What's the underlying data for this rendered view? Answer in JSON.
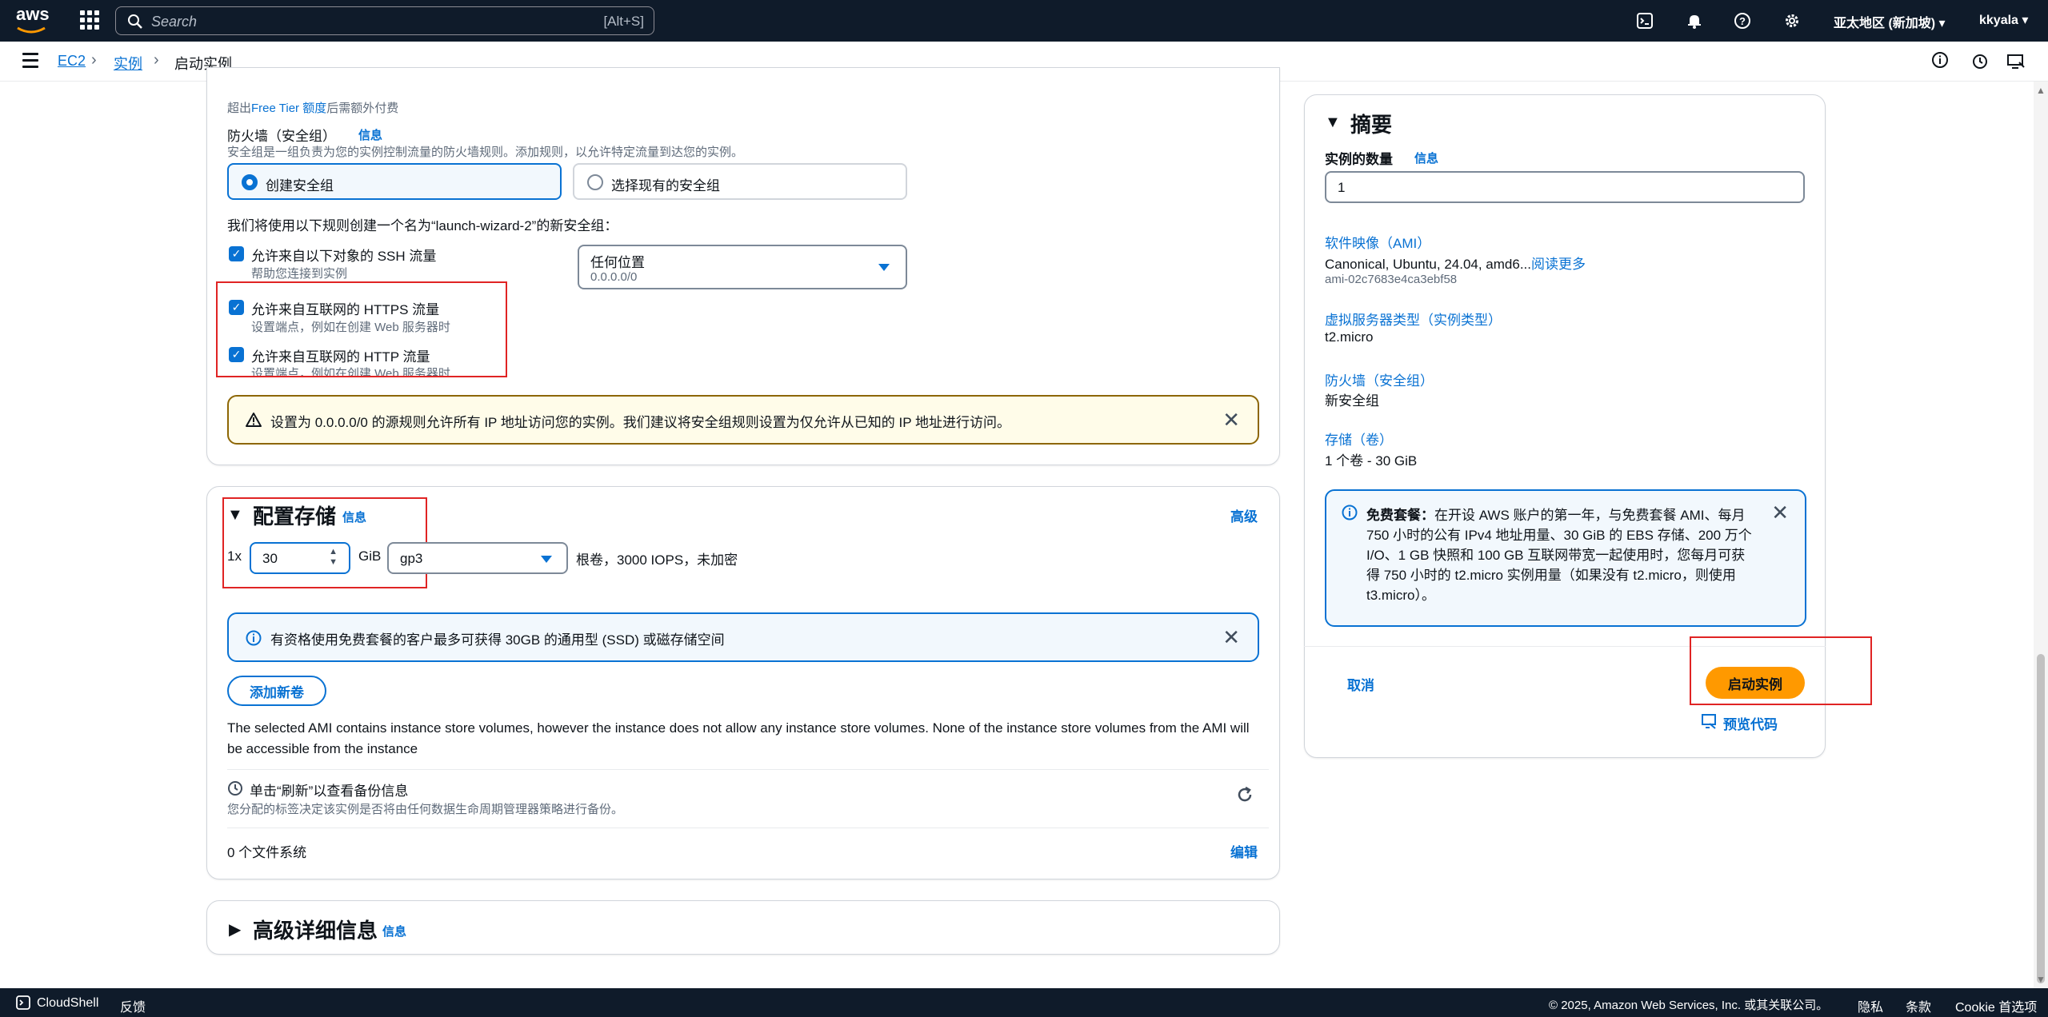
{
  "topnav": {
    "logo": "aws",
    "search_placeholder": "Search",
    "search_shortcut": "[Alt+S]",
    "region": "亚太地区 (新加坡) ▾",
    "user": "kkyala ▾"
  },
  "breadcrumb": {
    "items": [
      "EC2",
      "实例",
      "启动实例"
    ]
  },
  "security": {
    "over_free_tier_prefix": "超出",
    "over_free_tier_link": "Free Tier 额度",
    "over_free_tier_suffix": "后需额外付费",
    "firewall_label": "防火墙（安全组）",
    "info": "信息",
    "firewall_desc": "安全组是一组负责为您的实例控制流量的防火墙规则。添加规则，以允许特定流量到达您的实例。",
    "option_create": "创建安全组",
    "option_existing": "选择现有的安全组",
    "rule_intro": "我们将使用以下规则创建一个名为“launch-wizard-2”的新安全组：",
    "ssh_label": "允许来自以下对象的 SSH 流量",
    "ssh_desc": "帮助您连接到实例",
    "ssh_source": "任何位置",
    "ssh_source_cidr": "0.0.0.0/0",
    "https_label": "允许来自互联网的 HTTPS 流量",
    "https_desc": "设置端点，例如在创建 Web 服务器时",
    "http_label": "允许来自互联网的 HTTP 流量",
    "http_desc": "设置端点，例如在创建 Web 服务器时",
    "warning": "设置为 0.0.0.0/0 的源规则允许所有 IP 地址访问您的实例。我们建议将安全组规则设置为仅允许从已知的 IP 地址进行访问。"
  },
  "storage": {
    "title": "配置存储",
    "info": "信息",
    "advanced": "高级",
    "prefix": "1x",
    "size": "30",
    "unit": "GiB",
    "volume_type": "gp3",
    "desc": "根卷，3000 IOPS，未加密",
    "free_tier_info": "有资格使用免费套餐的客户最多可获得 30GB 的通用型 (SSD) 或磁存储空间",
    "add_volume": "添加新卷",
    "ami_note": "The selected AMI contains instance store volumes, however the instance does not allow any instance store volumes. None of the instance store volumes from the AMI will be accessible from the instance",
    "backup_title": "单击“刷新”以查看备份信息",
    "backup_desc": "您分配的标签决定该实例是否将由任何数据生命周期管理器策略进行备份。",
    "filesystems": "0 个文件系统",
    "edit": "编辑"
  },
  "advanced_details": {
    "title": "高级详细信息",
    "info": "信息"
  },
  "summary": {
    "title": "摘要",
    "count_label": "实例的数量",
    "info": "信息",
    "count_value": "1",
    "ami_label": "软件映像（AMI）",
    "ami_value": "Canonical, Ubuntu, 24.04, amd6...",
    "ami_more": "阅读更多",
    "ami_id": "ami-02c7683e4ca3ebf58",
    "type_label": "虚拟服务器类型（实例类型）",
    "type_value": "t2.micro",
    "fw_label": "防火墙（安全组）",
    "fw_value": "新安全组",
    "storage_label": "存储（卷）",
    "storage_value": "1 个卷 - 30 GiB",
    "free_tier_title": "免费套餐：",
    "free_tier_text": "在开设 AWS 账户的第一年，与免费套餐 AMI、每月 750 小时的公有 IPv4 地址用量、30 GiB 的 EBS 存储、200 万个 I/O、1 GB 快照和 100 GB 互联网带宽一起使用时，您每月可获得 750 小时的 t2.micro 实例用量（如果没有 t2.micro，则使用 t3.micro）。",
    "cancel": "取消",
    "launch": "启动实例",
    "preview_code": "预览代码"
  },
  "footer": {
    "cloudshell": "CloudShell",
    "feedback": "反馈",
    "copyright": "© 2025, Amazon Web Services, Inc. 或其关联公司。",
    "privacy": "隐私",
    "terms": "条款",
    "cookie": "Cookie 首选项"
  }
}
